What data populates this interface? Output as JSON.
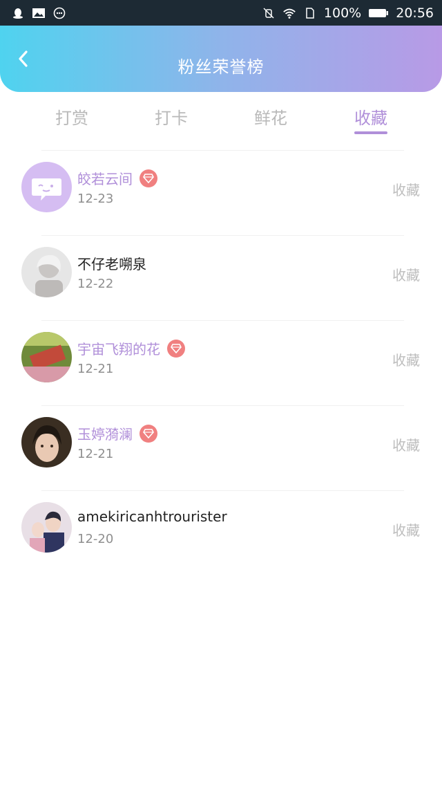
{
  "status_bar": {
    "battery": "100%",
    "time": "20:56",
    "icons_left": [
      "qq-icon",
      "image-icon",
      "chat-icon"
    ],
    "icons_right": [
      "mute-icon",
      "wifi-icon",
      "sim-icon",
      "battery-icon"
    ]
  },
  "header": {
    "title": "粉丝荣誉榜",
    "back_icon": "chevron-left-icon"
  },
  "tabs": [
    {
      "label": "打赏",
      "active": false
    },
    {
      "label": "打卡",
      "active": false
    },
    {
      "label": "鲜花",
      "active": false
    },
    {
      "label": "收藏",
      "active": true
    }
  ],
  "colors": {
    "accent": "#b08fd9",
    "header_gradient": [
      "#4fd3ef",
      "#b89ae6"
    ],
    "badge": "#f08080"
  },
  "list": [
    {
      "name": "皎若云间",
      "date": "12-23",
      "action": "收藏",
      "vip": true,
      "badge_icon": "diamond-icon",
      "avatar": "chat-bubble-avatar"
    },
    {
      "name": "不仔老嗍泉",
      "date": "12-22",
      "action": "收藏",
      "vip": false,
      "avatar": "photo-avatar"
    },
    {
      "name": "宇宙飞翔的花",
      "date": "12-21",
      "action": "收藏",
      "vip": true,
      "badge_icon": "diamond-icon",
      "avatar": "photo-avatar"
    },
    {
      "name": "玉婷漪澜",
      "date": "12-21",
      "action": "收藏",
      "vip": true,
      "badge_icon": "diamond-icon",
      "avatar": "photo-avatar"
    },
    {
      "name": "amekiricanhtrourister",
      "date": "12-20",
      "action": "收藏",
      "vip": false,
      "avatar": "photo-avatar"
    }
  ]
}
